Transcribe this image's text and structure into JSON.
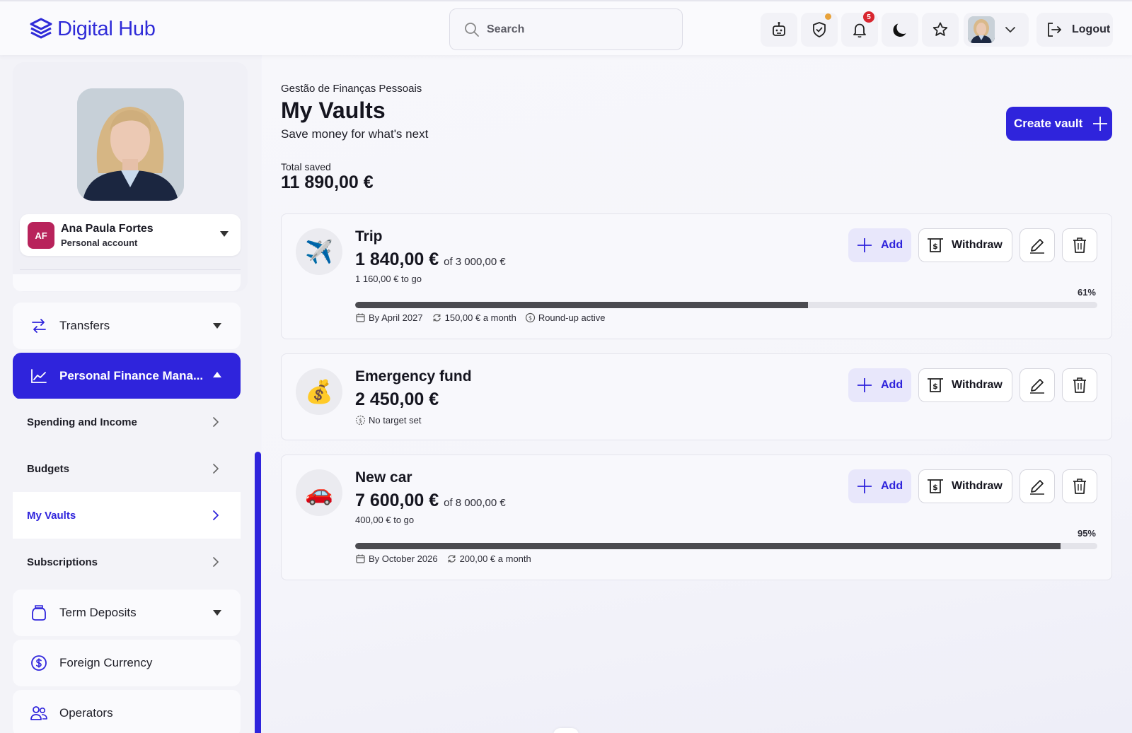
{
  "header": {
    "logo_text_1": "Digital",
    "logo_text_2": "Hub",
    "search_placeholder": "Search",
    "notifications_count": "5",
    "logout_label": "Logout",
    "icons": [
      "robot-icon",
      "shield-icon",
      "bell-icon",
      "moon-icon",
      "star-icon",
      "chevron-down-icon",
      "logout-icon"
    ]
  },
  "sidebar": {
    "profile": {
      "initials": "AF",
      "name": "Ana Paula Fortes",
      "account_type": "Personal account"
    },
    "items": [
      {
        "label": "Transfers",
        "icon": "transfer-icon"
      },
      {
        "label": "Personal Finance Mana...",
        "icon": "chart-icon",
        "active": true
      },
      {
        "label": "Term Deposits",
        "icon": "jar-icon"
      },
      {
        "label": "Foreign Currency",
        "icon": "currency-icon"
      },
      {
        "label": "Operators",
        "icon": "users-icon"
      }
    ],
    "subitems": [
      {
        "label": "Spending and Income"
      },
      {
        "label": "Budgets"
      },
      {
        "label": "My Vaults",
        "current": true
      },
      {
        "label": "Subscriptions"
      }
    ]
  },
  "main": {
    "breadcrumb": "Gestão de Finanças Pessoais",
    "title": "My Vaults",
    "subtitle": "Save money for what's next",
    "create_label": "Create vault",
    "total_label": "Total saved",
    "total_value": "11 890,00 €",
    "actions": {
      "add": "Add",
      "withdraw": "Withdraw"
    },
    "accent_color": "#2f24dc",
    "vaults": [
      {
        "emoji": "✈️",
        "name": "Trip",
        "amount": "1 840,00 €",
        "target": "of 3 000,00 €",
        "to_go": "1 160,00 € to go",
        "percent_label": "61%",
        "progress": 0.61,
        "meta": [
          "By April 2027",
          "150,00 € a month",
          "Round-up active"
        ]
      },
      {
        "emoji": "💰",
        "name": "Emergency fund",
        "amount": "2 450,00 €",
        "meta": [
          "No target set"
        ]
      },
      {
        "emoji": "🚗",
        "name": "New car",
        "amount": "7 600,00 €",
        "target": "of 8 000,00 €",
        "to_go": "400,00 € to go",
        "percent_label": "95%",
        "progress": 0.95,
        "meta": [
          "By October 2026",
          "200,00 € a month"
        ]
      }
    ]
  }
}
